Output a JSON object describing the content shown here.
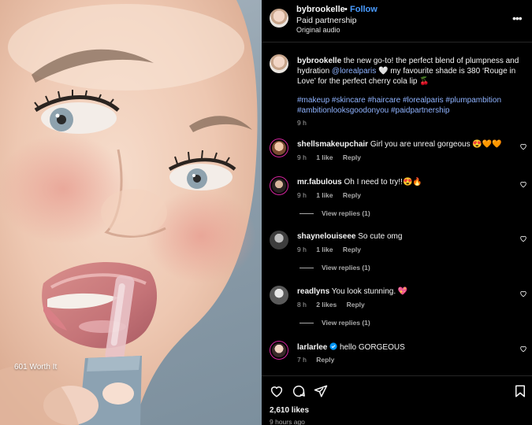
{
  "media": {
    "caption": "601 Worth It"
  },
  "post": {
    "username": "bybrookelle",
    "separator": "•",
    "follow_label": "Follow",
    "subtitle": "Paid partnership",
    "audio": "Original audio",
    "more_icon": "more-horizontal-icon",
    "caption_part1": " the new go-to! the perfect blend of plumpness and hydration ",
    "mention": "@lorealparis",
    "caption_part2": " 🤍 my favourite shade is 380 ‘Rouge in Love’ for the perfect cherry cola lip 🍒",
    "hashtags": "#makeup #skincare #haircare #lorealparis #plumpambition #ambitionlooksgoodonyou #paidpartnership",
    "caption_time": "9 h"
  },
  "comments": [
    {
      "username": "shellsmakeupchair",
      "text": "Girl you are unreal gorgeous 😍🧡🧡",
      "time": "9 h",
      "likes": "1 like",
      "reply": "Reply",
      "avatar_color": "#c98a6a",
      "ring": true
    },
    {
      "username": "mr.fabulous",
      "text": "Oh I need to try!!😍🔥",
      "time": "9 h",
      "likes": "1 like",
      "reply": "Reply",
      "avatar_color": "#5a4a4a",
      "ring": true,
      "view_replies": "View replies (1)"
    },
    {
      "username": "shaynelouiseee",
      "text": "So cute omg",
      "time": "9 h",
      "likes": "1 like",
      "reply": "Reply",
      "avatar_color": "#6f6f6f",
      "ring": false,
      "view_replies": "View replies (1)"
    },
    {
      "username": "readlyns",
      "text": "You look stunning. 💖",
      "time": "8 h",
      "likes": "2 likes",
      "reply": "Reply",
      "avatar_color": "#8a8a8a",
      "ring": false,
      "view_replies": "View replies (1)"
    },
    {
      "username": "larlarlee",
      "text": "hello GORGEOUS",
      "time": "7 h",
      "likes": "",
      "reply": "Reply",
      "avatar_color": "#d4a7b2",
      "ring": true,
      "verified": true
    }
  ],
  "footer": {
    "likes": "2,610 likes",
    "time_ago": "9 hours ago",
    "icons": [
      "heart-icon",
      "comment-icon",
      "share-icon",
      "bookmark-icon"
    ]
  },
  "colors": {
    "link_blue": "#4a9cff",
    "hashtag_blue": "#8fb3ff",
    "muted": "#a8a8a8",
    "story_ring": "#d6249f",
    "verified": "#0095f6"
  }
}
